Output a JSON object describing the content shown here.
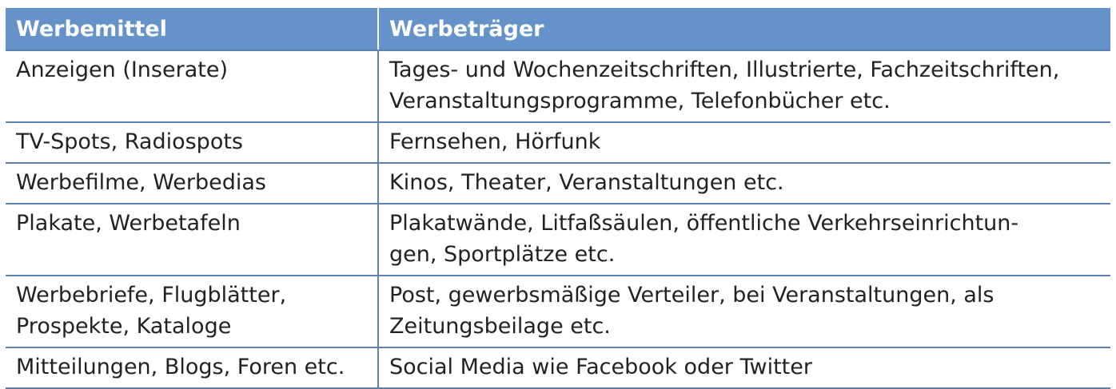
{
  "table": {
    "headers": [
      "Werbemittel",
      "Werbeträger"
    ],
    "rows": [
      {
        "col1": [
          "Anzeigen (Inserate)"
        ],
        "col2": [
          "Tages- und Wochenzeitschriften, Illustrierte, Fachzeitschriften,",
          "Veranstaltungsprogramme, Telefonbücher etc."
        ]
      },
      {
        "col1": [
          "TV-Spots, Radiospots"
        ],
        "col2": [
          "Fernsehen, Hörfunk"
        ]
      },
      {
        "col1": [
          "Werbefilme, Werbedias"
        ],
        "col2": [
          "Kinos, Theater, Veranstaltungen etc."
        ]
      },
      {
        "col1": [
          "Plakate, Werbetafeln"
        ],
        "col2": [
          "Plakatwände, Litfaßsäulen, öffentliche Verkehrseinrichtun-",
          "gen, Sportplätze etc."
        ]
      },
      {
        "col1": [
          "Werbebriefe, Flugblätter,",
          "Prospekte, Kataloge"
        ],
        "col2": [
          "Post, gewerbsmäßige Verteiler, bei Veranstaltungen, als",
          "Zeitungsbeilage etc."
        ]
      },
      {
        "col1": [
          "Mitteilungen, Blogs, Foren etc."
        ],
        "col2": [
          "Social Media wie Facebook oder Twitter"
        ]
      }
    ]
  },
  "colors": {
    "header_bg": "#6593c9",
    "header_text": "#ffffff",
    "rule": "#5b7fae",
    "text": "#222222"
  }
}
